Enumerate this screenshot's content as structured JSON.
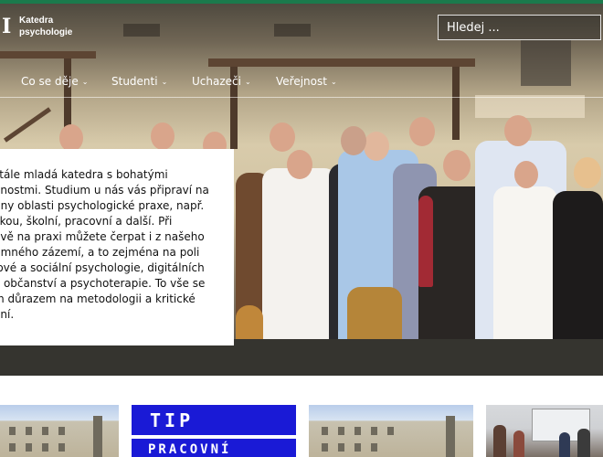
{
  "site": {
    "logo_glyph": "I",
    "logo_line1": "Katedra",
    "logo_line2": "psychologie",
    "accent_color": "#1b7a4c"
  },
  "search": {
    "placeholder": "Hledej ...",
    "icon": "search-icon"
  },
  "nav": {
    "items": [
      {
        "label": "Co se děje"
      },
      {
        "label": "Studenti"
      },
      {
        "label": "Uchazeči"
      },
      {
        "label": "Veřejnost"
      }
    ],
    "chevron": "⌄"
  },
  "intro": {
    "text": "stále mladá katedra s bohatými\nenostmi. Studium u nás vás připraví na\nhny oblasti psychologické praxe, např.\nckou, školní, pracovní a další. Při\navě na praxi můžete čerpat i z našeho\numného zázemí, a to zejména na poli\njové a sociální psychologie, digitálních\ní, občanství a psychoterapie. To vše se\nm důrazem na metodologii a kritické\není."
  },
  "cards": {
    "tip_title": "TIP",
    "tip_subtitle": "PRACOVNÍ"
  }
}
